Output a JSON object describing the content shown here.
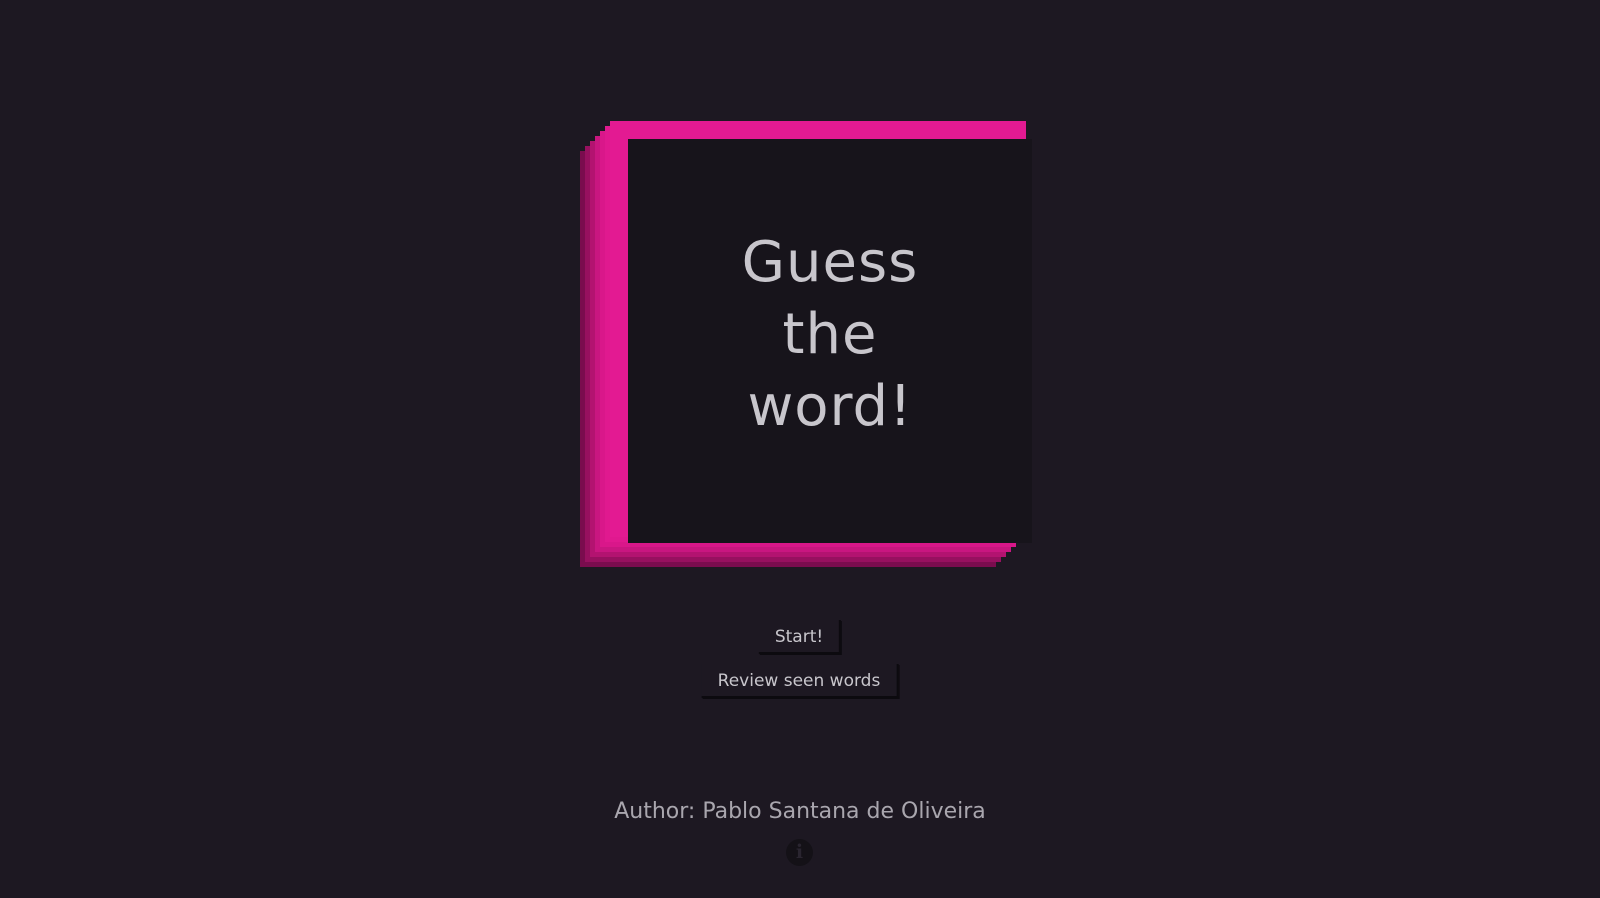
{
  "title": {
    "lines": [
      "Guess",
      "the",
      "word!"
    ]
  },
  "buttons": {
    "start_label": "Start!",
    "review_label": "Review seen words"
  },
  "footer": {
    "author_label": "Author:",
    "author_name": "Pablo Santana de Oliveira",
    "info_icon": "info-icon"
  },
  "colors": {
    "background": "#1d1822",
    "card_fill": "#17141b",
    "accent": "#e31a92",
    "text": "#c8c6cc"
  }
}
